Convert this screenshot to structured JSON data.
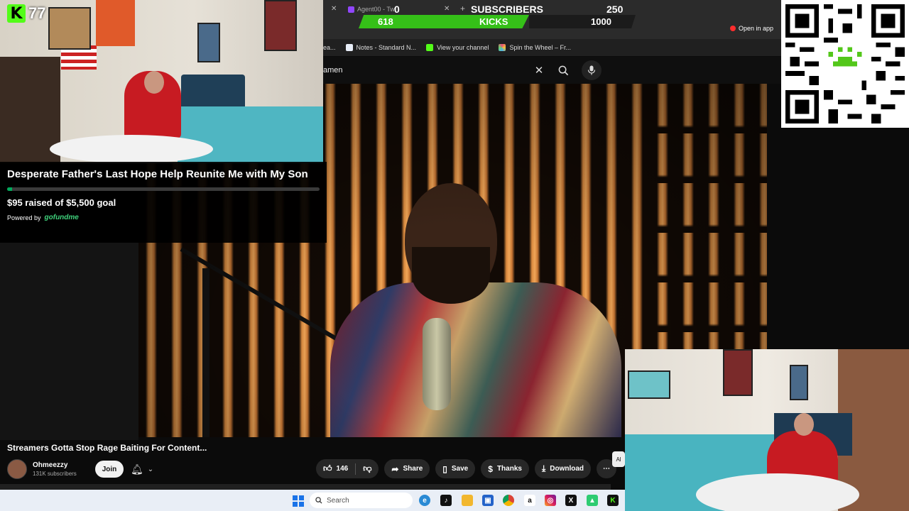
{
  "kick": {
    "logo": "K",
    "count": "77"
  },
  "gofundme": {
    "title": "Desperate Father's Last Hope Help Reunite Me with My Son",
    "raised_text": "$95 raised of $5,500 goal",
    "progress_fraction": 0.017,
    "powered_by": "Powered by",
    "brand": "gofundme"
  },
  "widget": {
    "tab_agent": "Agent00 - Tw",
    "subs_current": "0",
    "subs_label": "SUBSCRIBERS",
    "subs_goal": "250",
    "kicks_current": "618",
    "kicks_label": "KICKS",
    "kicks_goal": "1000"
  },
  "browser": {
    "open_in_app": "Open in app",
    "bookmarks": [
      {
        "label": "ea...",
        "icon": "bookmark-icon",
        "color": "#888888"
      },
      {
        "label": "Notes - Standard N...",
        "icon": "notes-icon",
        "color": "#e8eef8"
      },
      {
        "label": "View your channel",
        "icon": "kick-icon",
        "color": "#53fc18"
      },
      {
        "label": "Spin the Wheel – Fr...",
        "icon": "wheel-icon",
        "color": "#e94e77"
      }
    ],
    "search_value": "amen"
  },
  "youtube": {
    "title": "Streamers Gotta Stop Rage Baiting For Content...",
    "channel": "Ohmeezzy",
    "subscribers": "131K subscribers",
    "join": "Join",
    "likes": "146",
    "share": "Share",
    "save": "Save",
    "thanks": "Thanks",
    "download": "Download",
    "side_edge": "Al"
  },
  "taskbar": {
    "search_placeholder": "Search",
    "apps": [
      "file-explorer-icon",
      "edge-icon",
      "tiktok-icon",
      "folder-icon",
      "store-icon",
      "chrome-icon",
      "amazon-icon",
      "instagram-icon",
      "x-icon",
      "android-icon",
      "kick-icon"
    ]
  },
  "colors": {
    "kick_green": "#53fc18",
    "gofundme_green": "#02a95c"
  }
}
